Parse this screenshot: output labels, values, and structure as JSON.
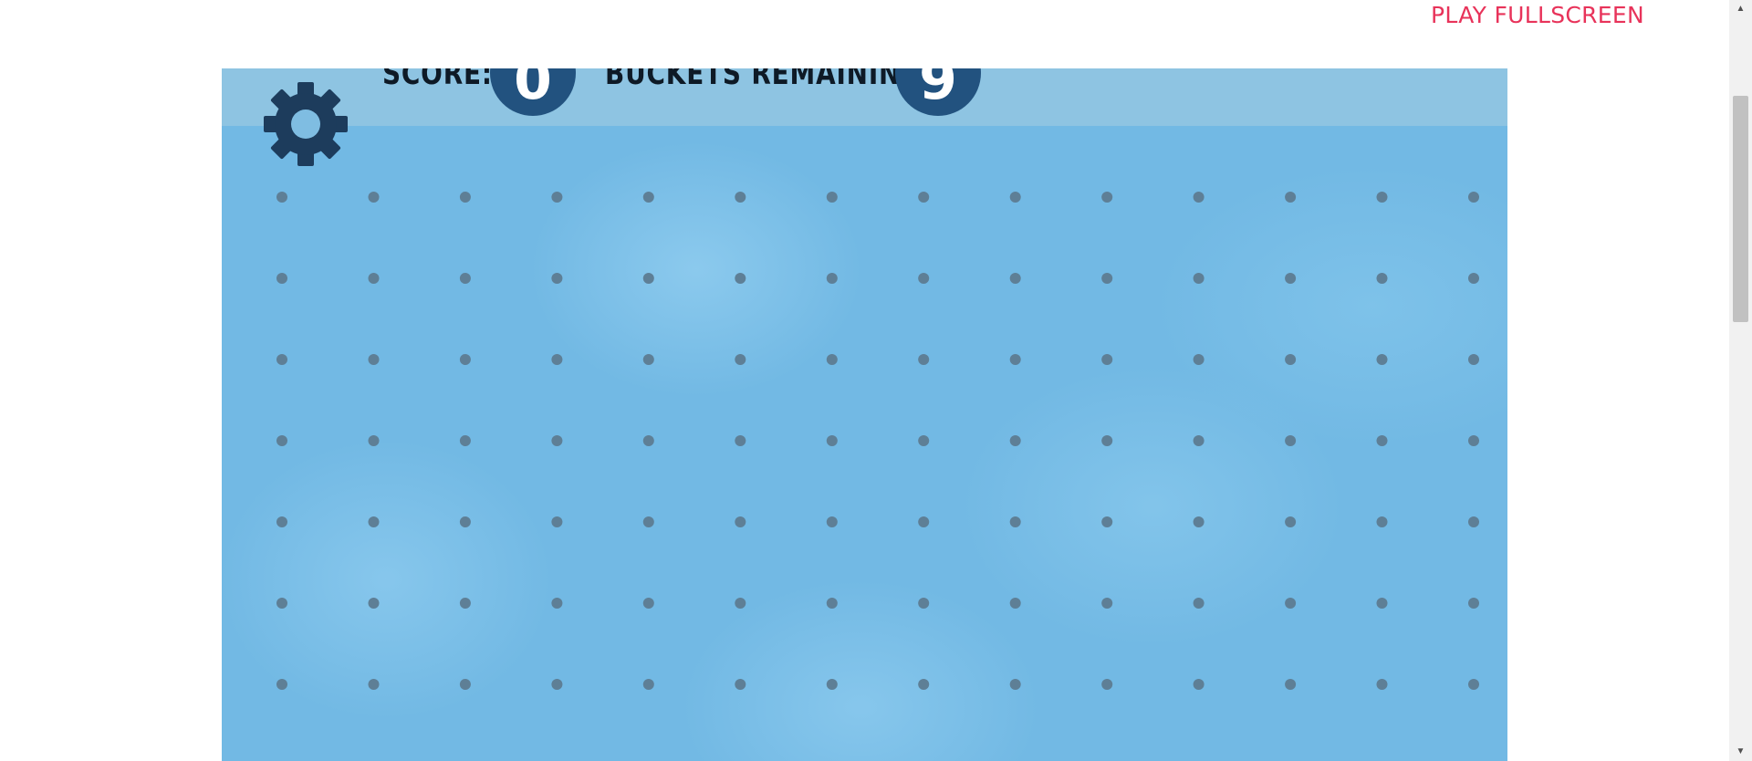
{
  "page": {
    "play_fullscreen_label": "PLAY FULLSCREEN"
  },
  "hud": {
    "score_label": "SCORE:",
    "score_value": "0",
    "buckets_label": "BUCKETS REMAINING:",
    "buckets_value": "9",
    "settings_icon": "gear-icon"
  },
  "board": {
    "peg_rows": 7,
    "peg_columns": 14
  },
  "colors": {
    "accent_link": "#e8335a",
    "hud_circle": "#22527f",
    "peg": "#5e7f96",
    "board_background": "#72b9e4",
    "header_bar": "#8ec4e2",
    "gear": "#1d3c5c"
  },
  "scrollbar": {
    "up_icon": "triangle-up-icon",
    "down_icon": "triangle-down-icon"
  }
}
